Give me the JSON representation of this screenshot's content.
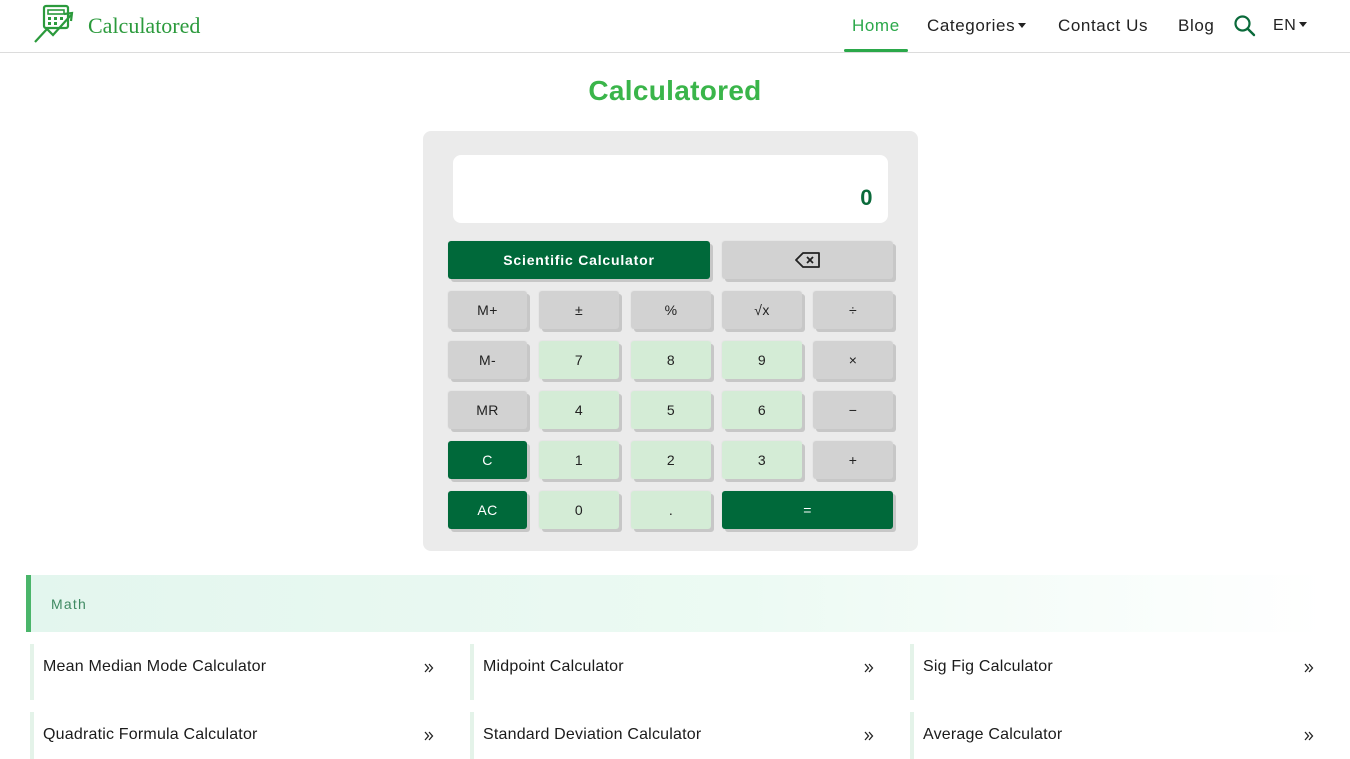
{
  "brand": {
    "name": "Calculatored",
    "accent": "#2ba84a",
    "dark_green": "#00693a"
  },
  "nav": {
    "home": "Home",
    "categories": "Categories",
    "contact": "Contact Us",
    "blog": "Blog",
    "language": "EN",
    "search_icon": "search-icon"
  },
  "page": {
    "title": "Calculatored"
  },
  "calculator": {
    "display": "0",
    "scientific": "Scientific Calculator",
    "backspace_icon": "backspace-icon",
    "keys": {
      "mplus": "M+",
      "plusminus": "±",
      "percent": "%",
      "sqrt": "√x",
      "divide": "÷",
      "mminus": "M-",
      "k7": "7",
      "k8": "8",
      "k9": "9",
      "multiply": "×",
      "mr": "MR",
      "k4": "4",
      "k5": "5",
      "k6": "6",
      "minus": "−",
      "clear": "C",
      "k1": "1",
      "k2": "2",
      "k3": "3",
      "plus": "+",
      "allclear": "AC",
      "k0": "0",
      "dot": ".",
      "equals": "="
    }
  },
  "section": {
    "title": "Math",
    "links": [
      "Mean Median Mode Calculator",
      "Midpoint Calculator",
      "Sig Fig Calculator",
      "Quadratic Formula Calculator",
      "Standard Deviation Calculator",
      "Average Calculator"
    ]
  }
}
